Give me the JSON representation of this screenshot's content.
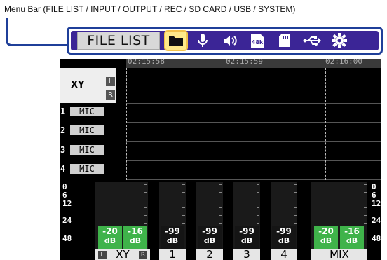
{
  "annotation": "Menu Bar (FILE LIST / INPUT / OUTPUT / REC / SD CARD / USB / SYSTEM)",
  "menubar": {
    "title": "FILE LIST",
    "icons": [
      "folder-icon",
      "microphone-icon",
      "speaker-icon",
      "rec-48k-icon",
      "sd-card-icon",
      "usb-icon",
      "gear-icon"
    ],
    "active_index": 0,
    "rec_rate": "48k"
  },
  "timeline": {
    "times": [
      "02:15:58",
      "02:15:59",
      "02:16:00"
    ]
  },
  "tracks": {
    "xy_label": "XY",
    "l": "L",
    "r": "R",
    "mics": [
      {
        "num": "1",
        "label": "MIC"
      },
      {
        "num": "2",
        "label": "MIC"
      },
      {
        "num": "3",
        "label": "MIC"
      },
      {
        "num": "4",
        "label": "MIC"
      }
    ]
  },
  "scale": [
    "0",
    "6",
    "12",
    "24",
    "48"
  ],
  "meters": [
    {
      "value": "-20",
      "unit": "dB",
      "style": "green"
    },
    {
      "value": "-16",
      "unit": "dB",
      "style": "green"
    },
    {
      "value": "-99",
      "unit": "dB",
      "style": "dark"
    },
    {
      "value": "-99",
      "unit": "dB",
      "style": "dark"
    },
    {
      "value": "-99",
      "unit": "dB",
      "style": "dark"
    },
    {
      "value": "-99",
      "unit": "dB",
      "style": "dark"
    },
    {
      "value": "-20",
      "unit": "dB",
      "style": "green"
    },
    {
      "value": "-16",
      "unit": "dB",
      "style": "green"
    }
  ],
  "tabs": {
    "xy": "XY",
    "ch1": "1",
    "ch2": "2",
    "ch3": "3",
    "ch4": "4",
    "mix": "MIX",
    "l": "L",
    "r": "R"
  },
  "colors": {
    "menubar_bg": "#3b2596",
    "menubar_border": "#1f3f99",
    "active_icon_bg": "#ffe98a",
    "level_green": "#3fb34a"
  }
}
